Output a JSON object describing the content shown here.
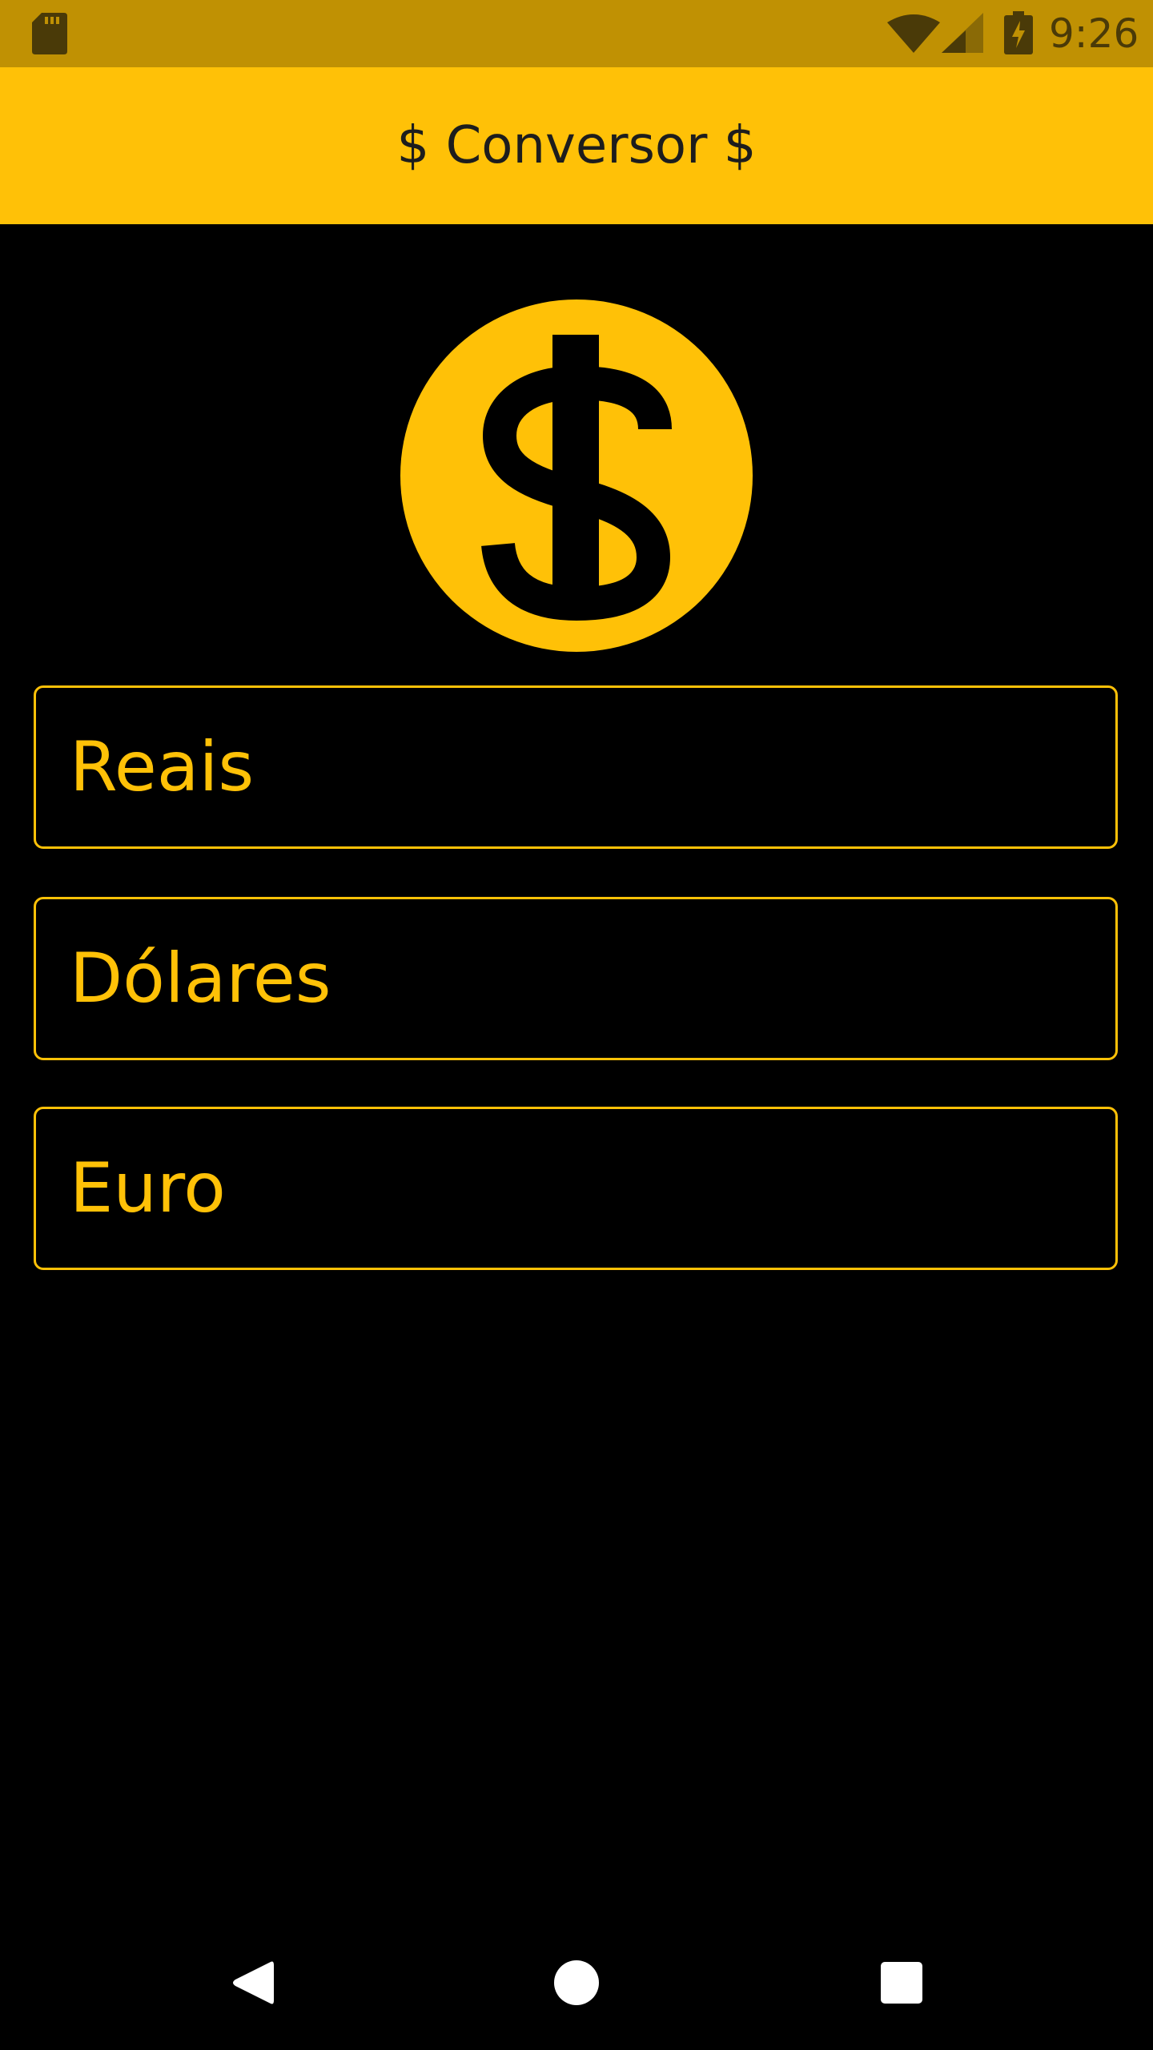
{
  "status_bar": {
    "time": "9:26",
    "icons": [
      "sd-card-icon",
      "wifi-icon",
      "cell-signal-icon",
      "battery-charging-icon"
    ]
  },
  "toolbar": {
    "title": "$ Conversor $"
  },
  "logo": {
    "icon": "dollar-coin-icon"
  },
  "fields": {
    "reais": {
      "label": "Reais"
    },
    "dolares": {
      "label": "Dólares"
    },
    "euro": {
      "label": "Euro"
    }
  },
  "nav_bar": {
    "icons": [
      "back-icon",
      "home-icon",
      "recents-icon"
    ]
  },
  "colors": {
    "accent": "#FFC107",
    "status_bar": "#C09103",
    "background": "#000000"
  }
}
